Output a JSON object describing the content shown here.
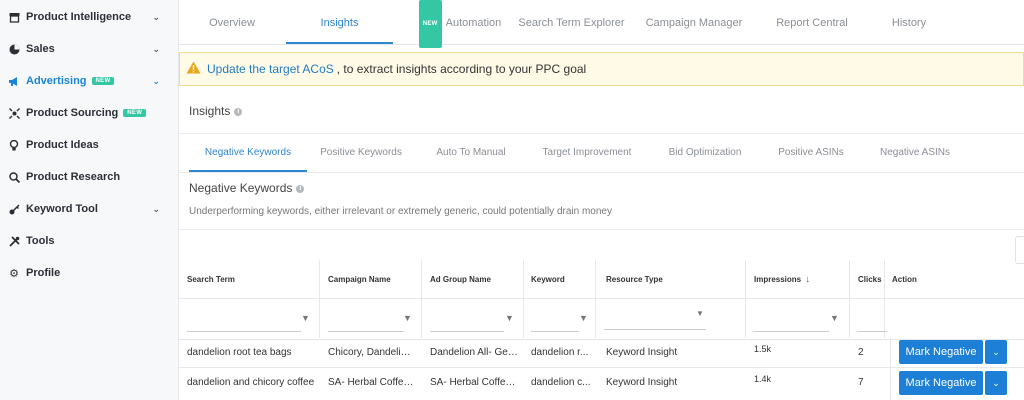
{
  "sidebar": {
    "items": [
      {
        "label": "Product Intelligence",
        "icon": "box-icon",
        "has_chevron": true
      },
      {
        "label": "Sales",
        "icon": "pie-chart-icon",
        "has_chevron": true
      },
      {
        "label": "Advertising",
        "icon": "megaphone-icon",
        "has_chevron": true,
        "badge": "NEW",
        "active": true
      },
      {
        "label": "Product Sourcing",
        "icon": "sourcing-icon",
        "badge": "NEW"
      },
      {
        "label": "Product Ideas",
        "icon": "lightbulb-icon"
      },
      {
        "label": "Product Research",
        "icon": "magnifier-icon"
      },
      {
        "label": "Keyword Tool",
        "icon": "key-icon",
        "has_chevron": true
      },
      {
        "label": "Tools",
        "icon": "tools-icon"
      },
      {
        "label": "Profile",
        "icon": "gear-icon"
      }
    ]
  },
  "top_tabs": [
    {
      "label": "Overview"
    },
    {
      "label": "Insights",
      "active": true
    },
    {
      "label": "Automation",
      "badge": "NEW"
    },
    {
      "label": "Search Term Explorer"
    },
    {
      "label": "Campaign Manager"
    },
    {
      "label": "Report Central"
    },
    {
      "label": "History"
    }
  ],
  "alert": {
    "link_text": "Update the target ACoS",
    "text": ", to extract insights according to your PPC goal",
    "color": "#fffbe6"
  },
  "insights_title": "Insights",
  "sub_tabs": [
    {
      "label": "Negative Keywords",
      "active": true
    },
    {
      "label": "Positive Keywords"
    },
    {
      "label": "Auto To Manual"
    },
    {
      "label": "Target Improvement"
    },
    {
      "label": "Bid Optimization"
    },
    {
      "label": "Positive ASINs"
    },
    {
      "label": "Negative ASINs"
    }
  ],
  "section": {
    "title": "Negative Keywords",
    "description": "Underperforming keywords, either irrelevant or extremely generic, could potentially drain money"
  },
  "table": {
    "columns": [
      "Search Term",
      "Campaign Name",
      "Ad Group Name",
      "Keyword",
      "Resource Type",
      "Impressions",
      "Clicks",
      "Action"
    ],
    "rows": [
      {
        "search_term": "dandelion root tea bags",
        "campaign": "Chicory, Dandelion...",
        "ad_group": "Dandelion All- Gen...",
        "keyword": "dandelion r...",
        "resource_type": "Keyword Insight",
        "impressions": "1.5k",
        "clicks": "2",
        "action": "Mark Negative"
      },
      {
        "search_term": "dandelion and chicory coffee",
        "campaign": "SA- Herbal Coffee-...",
        "ad_group": "SA- Herbal Coffee-...",
        "keyword": "dandelion c...",
        "resource_type": "Keyword Insight",
        "impressions": "1.4k",
        "clicks": "7",
        "action": "Mark Negative"
      }
    ]
  },
  "colors": {
    "accent": "#2e86d1",
    "button": "#1d7fd6",
    "badge": "#34c7a5",
    "warning": "#e9a51d"
  }
}
